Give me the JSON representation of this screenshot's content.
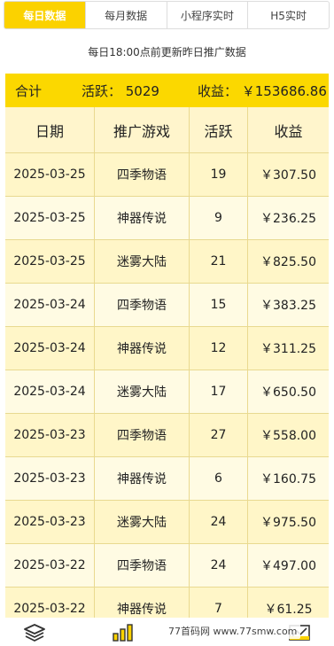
{
  "tabs": [
    {
      "label": "每日数据",
      "active": true
    },
    {
      "label": "每月数据",
      "active": false
    },
    {
      "label": "小程序实时",
      "active": false
    },
    {
      "label": "H5实时",
      "active": false
    }
  ],
  "notice": "每日18:00点前更新昨日推广数据",
  "summary": {
    "label": "合计",
    "active_text": "活跃： 5029",
    "income_text": "收益： ￥153686.86"
  },
  "table": {
    "headers": [
      "日期",
      "推广游戏",
      "活跃",
      "收益"
    ],
    "rows": [
      [
        "2025-03-25",
        "四季物语",
        "19",
        "￥307.50"
      ],
      [
        "2025-03-25",
        "神器传说",
        "9",
        "￥236.25"
      ],
      [
        "2025-03-25",
        "迷雾大陆",
        "21",
        "￥825.50"
      ],
      [
        "2025-03-24",
        "四季物语",
        "15",
        "￥383.25"
      ],
      [
        "2025-03-24",
        "神器传说",
        "12",
        "￥311.25"
      ],
      [
        "2025-03-24",
        "迷雾大陆",
        "17",
        "￥650.50"
      ],
      [
        "2025-03-23",
        "四季物语",
        "27",
        "￥558.00"
      ],
      [
        "2025-03-23",
        "神器传说",
        "6",
        "￥160.75"
      ],
      [
        "2025-03-23",
        "迷雾大陆",
        "24",
        "￥975.50"
      ],
      [
        "2025-03-22",
        "四季物语",
        "24",
        "￥497.00"
      ],
      [
        "2025-03-22",
        "神器传说",
        "7",
        "￥61.25"
      ]
    ]
  },
  "bottom_nav": {
    "icons": [
      "layers-icon",
      "bar-chart-icon",
      "chart-icon"
    ]
  },
  "watermark": "77首码网 www.77smw.com",
  "colors": {
    "accent": "#fbd200",
    "row_odd": "#fff6c8",
    "row_even": "#fffbe3"
  }
}
